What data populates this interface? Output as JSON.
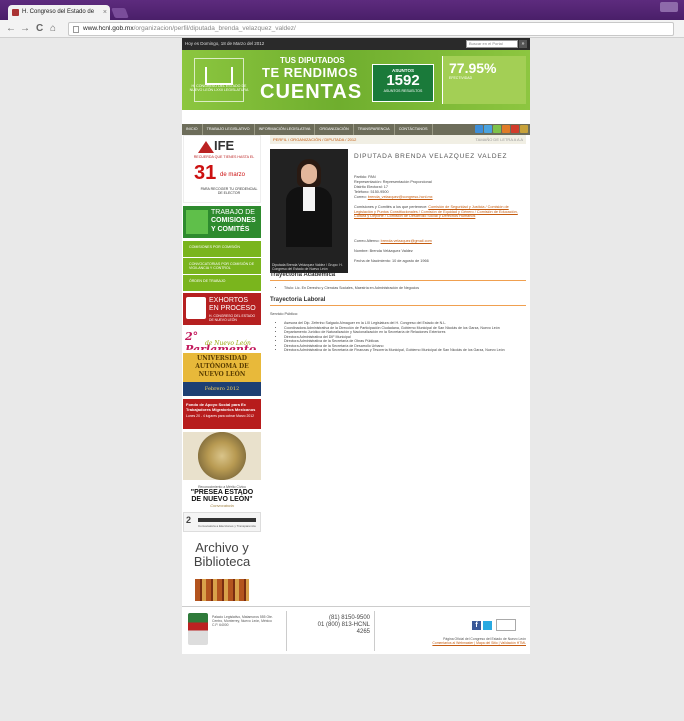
{
  "browser": {
    "tab_title": "H. Congreso del Estado de",
    "tab_close": "×",
    "url_host": "www.hcnl.gob.mx",
    "url_path": "/organizacion/perfil/diputada_brenda_velazquez_valdez/",
    "nav_back": "←",
    "nav_forward": "→",
    "nav_reload": "C",
    "nav_home": "⌂"
  },
  "site": {
    "date": "Hoy es Domingo, 18 de Marzo del 2012",
    "search_placeholder": "Buscar en el Portal",
    "search_button": "»",
    "banner": {
      "line1": "TUS DIPUTADOS",
      "line2": "TE RENDIMOS",
      "line3": "CUENTAS",
      "logo_text": "H. CONGRESO DEL ESTADO DE NUEVO LEÓN LXXII LEGISLATURA",
      "box1_title": "ASUNTOS",
      "box1_number": "1592",
      "box1_sub": "ASUNTOS RESUELTOS",
      "box2_number": "77.95%",
      "box2_sub": "EFECTIVIDAD"
    },
    "menu": [
      "INICIO",
      "TRABAJO LEGISLATIVO",
      "INFORMACIÓN LEGISLATIVA",
      "ORGANIZACIÓN",
      "TRANSPARENCIA",
      "CONTÁCTANOS"
    ],
    "menu_icon_colors": [
      "#3d8ed8",
      "#4aa3df",
      "#7fc24a",
      "#e07b28",
      "#d23c2a",
      "#c8a23a"
    ]
  },
  "sidebar": {
    "ife": {
      "logo": "IFE",
      "line1": "RECUERDA QUE TIENES HASTA EL",
      "day": "31",
      "month": "de marzo",
      "line2": "PARA RECOGER TU CREDENCIAL DE ELECTOR"
    },
    "trabajo": {
      "l1": "TRABAJO DE",
      "l2": "COMISIONES",
      "l3": "Y COMITÉS"
    },
    "green_buttons": [
      "COMISIONES POR COMISIÓN",
      "CONVOCATORIAS POR COMISIÓN DE VIGILANCIA Y CONTROL",
      "ÓRDEN DE TRABAJO"
    ],
    "exhortos": {
      "l1": "EXHORTOS",
      "l2": "EN PROCESO",
      "l3": "H. CONGRESO DEL ESTADO DE NUEVO LEÓN"
    },
    "parlamento": {
      "l1": "2° Parlamento",
      "l2": "de Nuevo León"
    },
    "uanl": {
      "l1": "UNIVERSIDAD",
      "l2": "AUTÓNOMA DE",
      "l3": "NUEVO LEÓN",
      "date": "Febrero 2012"
    },
    "fondo": {
      "l1": "Fondo de Apoyo Social para Ex Trabajadores Migratorios Mexicanos",
      "l2": "Lunes 20 - 4 lugares para cobrar Marzo 2012"
    },
    "presea": {
      "l0": "Reconocimiento a Mérito Cívico",
      "l1": "\"PRESEA ESTADO",
      "l2": "DE NUEVO LEÓN\"",
      "l3": "Convocatoria"
    },
    "z": {
      "l1": "2",
      "l2": "Convocatoria a Elecciones y Transparencia"
    },
    "archivo": {
      "l1": "Archivo y",
      "l2": "Biblioteca"
    }
  },
  "profile": {
    "crumbs": "PERFIL / ORGANIZACIÓN / DIPUTADA / 2012",
    "crumbs_right": "TAMAÑO DE LETRA  A  A  A",
    "name": "DIPUTADA BRENDA VELAZQUEZ VALDEZ",
    "photo_caption": "Diputada Brenda Velázquez Valdez / Grupo: H. Congreso del Estado de Nuevo León",
    "party": "Partido: PAN",
    "representation": "Representación: Representación Proporcional",
    "district": "Distrito Electoral: 17",
    "phone": "Teléfono: 5150-9500",
    "email_label": "Correo:",
    "email": "brenda_velazquez@congreso-hcnl.mx",
    "commissions_intro": "Comisiones y Comités a los que pertenece:",
    "commissions": "Comisión de Seguridad y Justicia / Comisión de Legislación y Puntos Constitucionales / Comisión de Equidad y Género / Comisión de Educación, Cultura y Deporte / Comisión de Desarrollo Social y Derechos Humanos",
    "alt_email_label": "Correo Alterno:",
    "alt_email": "brenda.velazquez@gmail.com",
    "nickname": "Nombre: Brenda Velázquez Valdez",
    "birth": "Fecha de Nacimiento: 10 de agosto de 1966",
    "academic_title": "Trayectoria Académica",
    "academic": [
      "Título: Lic. En Derecho y Ciencias Sociales, Maestría en Administración de Negocios"
    ],
    "work_title": "Trayectoria Laboral",
    "work_intro": "Servicio Público:",
    "work": [
      "Asesora del Dip. Zeferino Salgado Almaguer en la LXI Legislatura del H. Congreso del Estado de N.L.",
      "Coordinadora Administrativa de la Dirección de Participación Ciudadana, Gobierno Municipal de San Nicolás de los Garza, Nuevo León",
      "Departamento Jurídico de Naturalización y Nacionalización en la Secretaría de Relaciones Exteriores",
      "Directora Administrativa del DIF Municipal",
      "Directora Administrativa de la Secretaría de Obras Públicas",
      "Directora Administrativa de la Secretaría de Desarrollo Urbano",
      "Directora Administrativa de la Secretaría de Finanzas y Tesorería Municipal, Gobierno Municipal de San Nicolás de los Garza, Nuevo León"
    ]
  },
  "footer": {
    "address": "Palacio Legislativo, Matamoros 555 Ote. Centro, Monterrey, Nuevo León, México C.P. 64000",
    "phone1": "(81) 8150-9500",
    "phone2": "01 (800) 813-HCNL",
    "phone3": "4265",
    "fb": "f",
    "copy": "Página Oficial del Congreso del Estado de Nuevo León",
    "links": "Comentarios al Webmaster | Mapa del Sitio | Validación HTML"
  }
}
